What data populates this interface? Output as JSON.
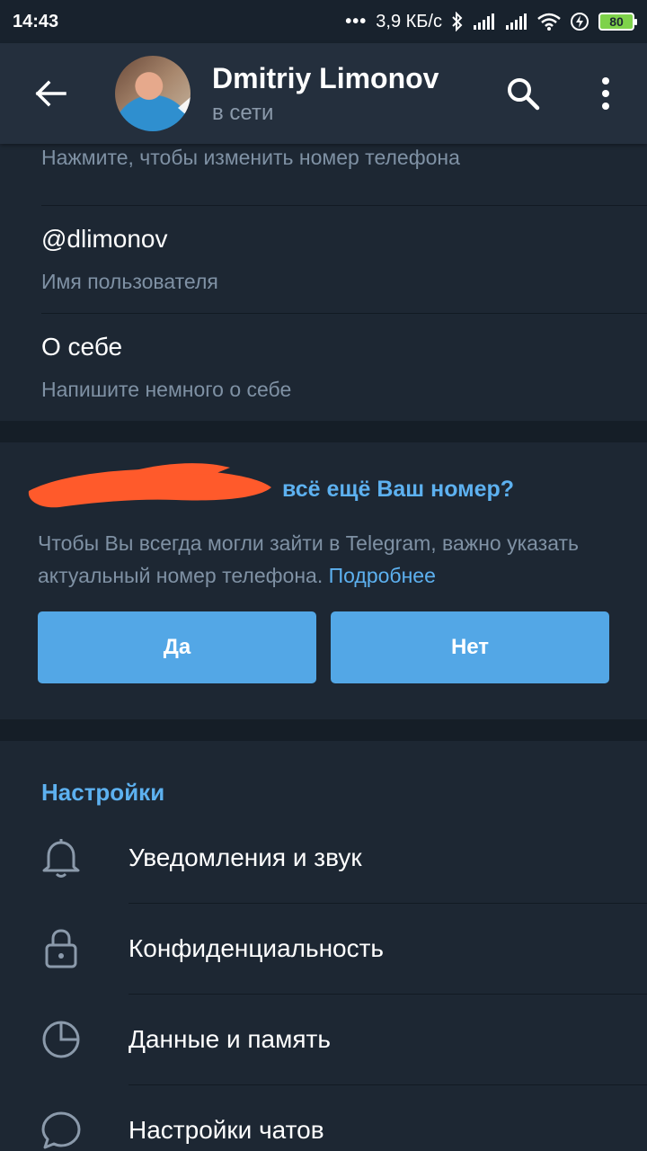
{
  "status_bar": {
    "time": "14:43",
    "dots": "•••",
    "speed": "3,9 КБ/с",
    "battery": "80"
  },
  "header": {
    "name": "Dmitriy Limonov",
    "status": "в сети"
  },
  "info": {
    "phone_hint": "Нажмите, чтобы изменить номер телефона",
    "username_value": "@dlimonov",
    "username_label": "Имя пользователя",
    "bio_value": "О себе",
    "bio_label": "Напишите немного о себе"
  },
  "number_check": {
    "question": "всё ещё Ваш номер?",
    "text": "Чтобы Вы всегда могли зайти в Telegram, важно указать актуальный номер телефона.",
    "more_link": "Подробнее",
    "yes_label": "Да",
    "no_label": "Нет"
  },
  "settings": {
    "title": "Настройки",
    "items": [
      {
        "label": "Уведомления и звук",
        "icon": "bell-icon"
      },
      {
        "label": "Конфиденциальность",
        "icon": "lock-icon"
      },
      {
        "label": "Данные и память",
        "icon": "pie-chart-icon"
      },
      {
        "label": "Настройки чатов",
        "icon": "chat-bubble-icon"
      }
    ]
  },
  "colors": {
    "background": "#1d2733",
    "header": "#242f3d",
    "accent": "#5db1f0",
    "button": "#53a7e6",
    "scribble": "#ff5a2b"
  }
}
